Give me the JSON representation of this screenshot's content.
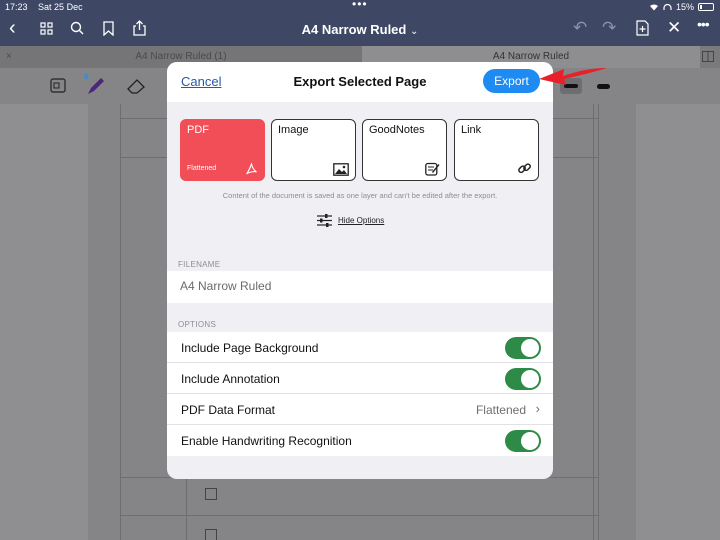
{
  "status_bar": {
    "time": "17:23",
    "date": "Sat 25 Dec",
    "battery": "15%"
  },
  "nav_bar": {
    "doc_title": "A4 Narrow Ruled",
    "title_chevron": "⌄"
  },
  "tabs": [
    {
      "label": "A4 Narrow Ruled (1)",
      "close": "×"
    },
    {
      "label": "A4 Narrow Ruled"
    }
  ],
  "modal": {
    "cancel_label": "Cancel",
    "title": "Export Selected Page",
    "export_label": "Export",
    "formats": [
      {
        "label": "PDF",
        "sub": "Flattened",
        "icon": "pdf-icon",
        "selected": true
      },
      {
        "label": "Image",
        "icon": "image-icon",
        "selected": false
      },
      {
        "label": "GoodNotes",
        "icon": "goodnotes-icon",
        "selected": false
      },
      {
        "label": "Link",
        "icon": "link-icon",
        "selected": false
      }
    ],
    "description": "Content of the document is saved as one layer and can't be edited after the export.",
    "hide_options_label": "Hide Options",
    "filename_section": "FILENAME",
    "filename_value": "A4 Narrow Ruled",
    "options_section": "OPTIONS",
    "options": [
      {
        "label": "Include Page Background",
        "type": "toggle",
        "on": true
      },
      {
        "label": "Include Annotation",
        "type": "toggle",
        "on": true
      },
      {
        "label": "PDF Data Format",
        "type": "select",
        "value": "Flattened"
      },
      {
        "label": "Enable Handwriting Recognition",
        "type": "toggle",
        "on": true
      }
    ]
  },
  "colors": {
    "accent": "#1d8bf1",
    "selected_format": "#f14e57",
    "toggle_on": "#2e8b47",
    "annotation_arrow": "#e8202a"
  }
}
